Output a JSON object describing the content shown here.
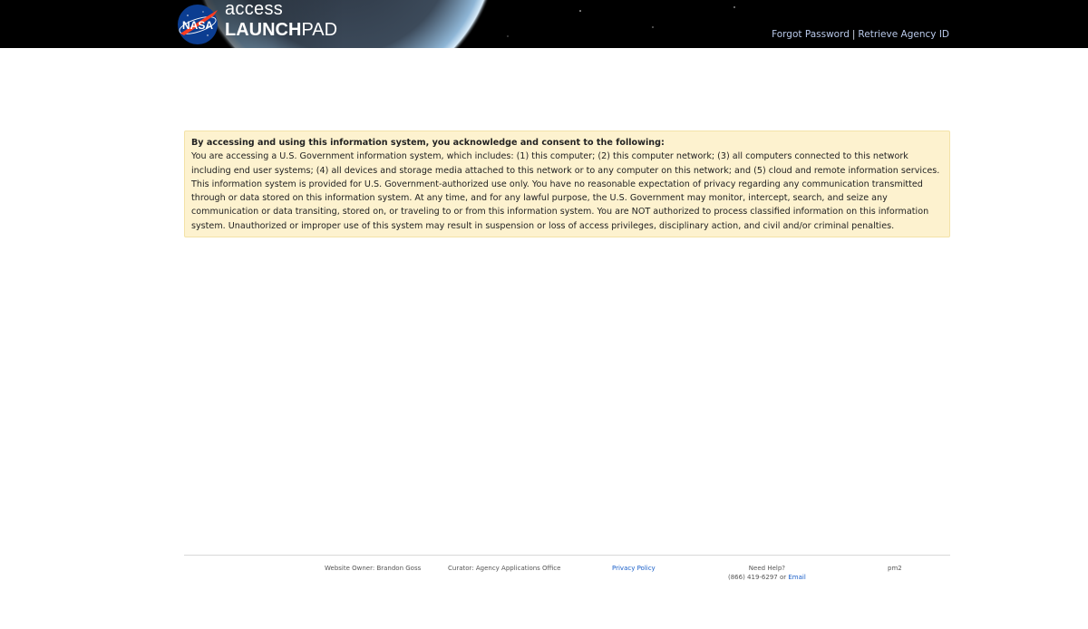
{
  "header": {
    "brand_top": "access",
    "brand_bold": "LAUNCH",
    "brand_light": "PAD",
    "logo_text": "NASA",
    "links": {
      "forgot_password": "Forgot Password",
      "separator": "|",
      "retrieve_agency_id": "Retrieve Agency ID"
    }
  },
  "notice": {
    "title": "By accessing and using this information system, you acknowledge and consent to the following:",
    "body": "You are accessing a U.S. Government information system, which includes: (1) this computer; (2) this computer network; (3) all computers connected to this network including end user systems; (4) all devices and storage media attached to this network or to any computer on this network; and (5) cloud and remote information services. This information system is provided for U.S. Government-authorized use only. You have no reasonable expectation of privacy regarding any communication transmitted through or data stored on this information system. At any time, and for any lawful purpose, the U.S. Government may monitor, intercept, search, and seize any communication or data transiting, stored on, or traveling to or from this information system. You are NOT authorized to process classified information on this information system. Unauthorized or improper use of this system may result in suspension or loss of access privileges, disciplinary action, and civil and/or criminal penalties."
  },
  "footer": {
    "owner": "Website Owner: Brandon Goss",
    "curator": "Curator: Agency Applications Office",
    "privacy": "Privacy Policy",
    "help_label": "Need Help?",
    "help_phone": "(866) 419-6297 or",
    "help_email": "Email",
    "server": "pm2"
  },
  "colors": {
    "header_bg": "#000000",
    "notice_bg": "#fdf2cf",
    "link": "#1a5fc9"
  }
}
